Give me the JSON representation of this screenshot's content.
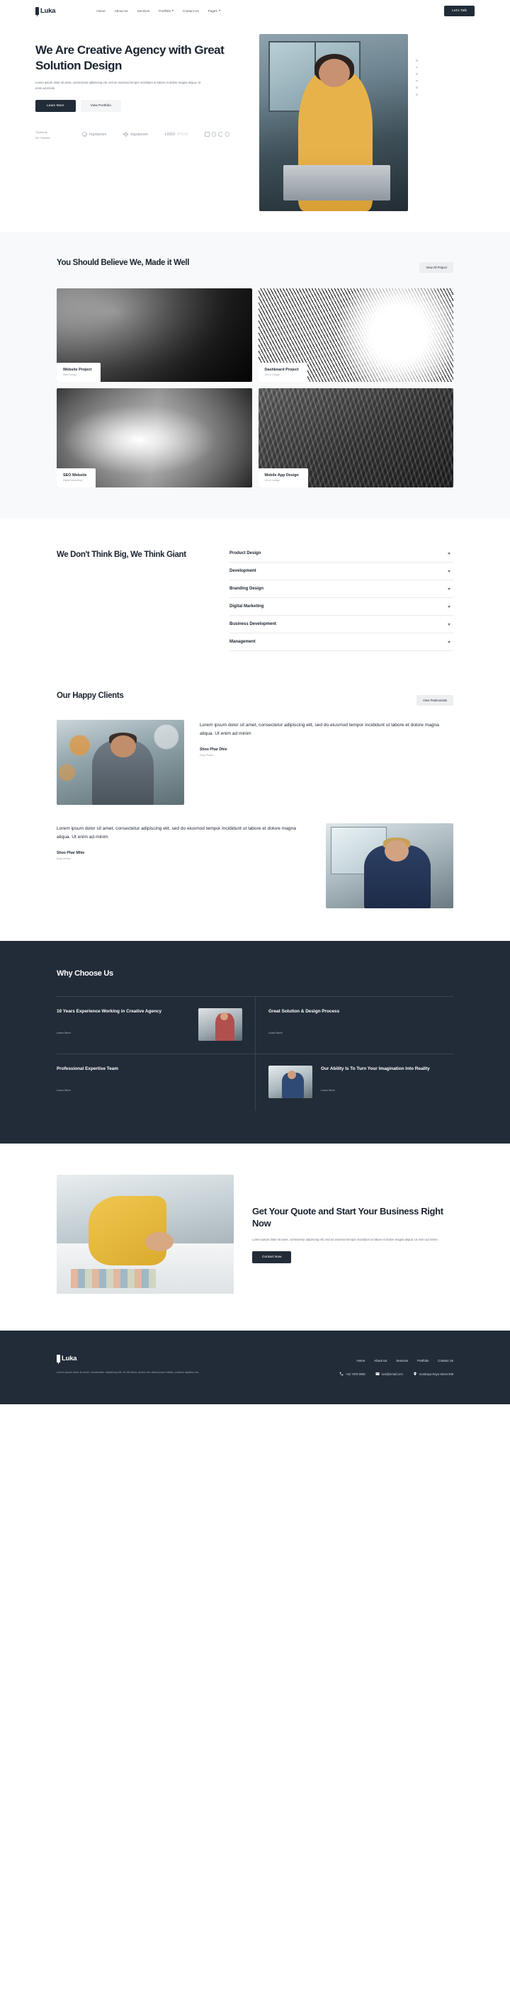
{
  "brand": {
    "name": "Luka",
    "mark_icon": "bookmark-icon"
  },
  "header": {
    "nav": [
      {
        "label": "Home",
        "has_caret": false
      },
      {
        "label": "About Us",
        "has_caret": false
      },
      {
        "label": "Services",
        "has_caret": false
      },
      {
        "label": "Portfolio",
        "has_caret": true
      },
      {
        "label": "Contact Us",
        "has_caret": false
      },
      {
        "label": "Pages",
        "has_caret": true
      }
    ],
    "cta_label": "Let's Talk"
  },
  "hero": {
    "title": "We Are Creative Agency with Great Solution Design",
    "subtitle": "Lorem ipsum dolor sit amet, consectetur adipiscing elit, sed do eiusmod tempor incididunt ut labore et dolore magna aliqua. Ut enim ad minim",
    "primary_btn": "Learn More",
    "secondary_btn": "View Portfolio",
    "trusted_label": "Trusted by\n50+ Partners",
    "logos": [
      {
        "text": "logoipsum",
        "icon": "circle-slash-icon",
        "faded": false
      },
      {
        "text": "logoipsum",
        "icon": "flower-dots-icon",
        "faded": false
      },
      {
        "text": "LOGO",
        "text2": "IPSUM",
        "icon": "none",
        "faded": true
      },
      {
        "text": "LOGO",
        "icon": "square-circles-icon",
        "faded": false
      }
    ]
  },
  "portfolio": {
    "title": "You Should Believe We, Made it Well",
    "view_all_label": "View All Project",
    "projects": [
      {
        "title": "Website Project",
        "category": "Web Design",
        "texture": "tex-crumple"
      },
      {
        "title": "Dashboard Project",
        "category": "UI/UX Design",
        "texture": "tex-lines"
      },
      {
        "title": "SEO Website",
        "category": "Digital Marketing",
        "texture": "tex-smoke"
      },
      {
        "title": "Mobile App Design",
        "category": "UI/UX Design",
        "texture": "tex-fabric"
      }
    ]
  },
  "services": {
    "title": "We Don't Think Big, We Think Giant",
    "items": [
      {
        "label": "Product Design"
      },
      {
        "label": "Development"
      },
      {
        "label": "Branding Design"
      },
      {
        "label": "Digital Marketing"
      },
      {
        "label": "Business Development"
      },
      {
        "label": "Management"
      }
    ]
  },
  "testimonials": {
    "title": "Our Happy Clients",
    "view_label": "View Testimonials",
    "items": [
      {
        "quote": "Lorem ipsum dolor sit amet, consectetur adipiscing elit, sed do eiusmod tempor incididunt ut labore et dolore magna aliqua. Ut enim ad minim",
        "name": "Shoo Phar Dhie",
        "role": "Easy Phase",
        "photo": "ph-a",
        "reversed": false
      },
      {
        "quote": "Lorem ipsum dolor sit amet, consectetur adipiscing elit, sed do eiusmod tempor incididunt ut labore et dolore magna aliqua. Ut enim ad minim",
        "name": "Shoo Phar Mhie",
        "role": "Easy Inshoe",
        "photo": "ph-b",
        "reversed": true
      }
    ]
  },
  "why": {
    "title": "Why Choose Us",
    "cells": [
      {
        "title": "10 Years Experience Working in Creative Agency",
        "link": "Learn More",
        "image": "wi-1",
        "image_first": false
      },
      {
        "title": "Great Solution & Design Process",
        "link": "Learn More",
        "image": "",
        "image_first": false
      },
      {
        "title": "Professional Expertise Team",
        "link": "Learn More",
        "image": "",
        "image_first": false
      },
      {
        "title": "Our Ability Is To Turn Your Imagination Into Reality",
        "link": "Learn More",
        "image": "wi-2",
        "image_first": true
      }
    ]
  },
  "quote_section": {
    "title": "Get Your Quote and Start Your Business Right Now",
    "subtitle": "Lorem ipsum dolor sit amet, consectetur adipiscing elit, sed do eiusmod tempor incididunt ut labore et dolore magna aliqua. Ut enim ad minim",
    "button": "Contact Now"
  },
  "footer": {
    "description": "Lorem ipsum dolor sit amet, consectetur adipiscing elit. Ut elit tellus, luctus nec ullamcorper mattis, pulvinar dapibus leo.",
    "nav": [
      {
        "label": "Home"
      },
      {
        "label": "About Us"
      },
      {
        "label": "Services"
      },
      {
        "label": "Portfolio"
      },
      {
        "label": "Contact Us"
      }
    ],
    "contacts": [
      {
        "icon": "phone-icon",
        "text": "+62 7878 9995"
      },
      {
        "icon": "mail-icon",
        "text": "luck@email.com"
      },
      {
        "icon": "location-icon",
        "text": "Surabaya Raya Street 908"
      }
    ]
  },
  "colors": {
    "dark": "#222c38",
    "light_bg": "#f8f9fa",
    "muted": "#6b7480"
  }
}
